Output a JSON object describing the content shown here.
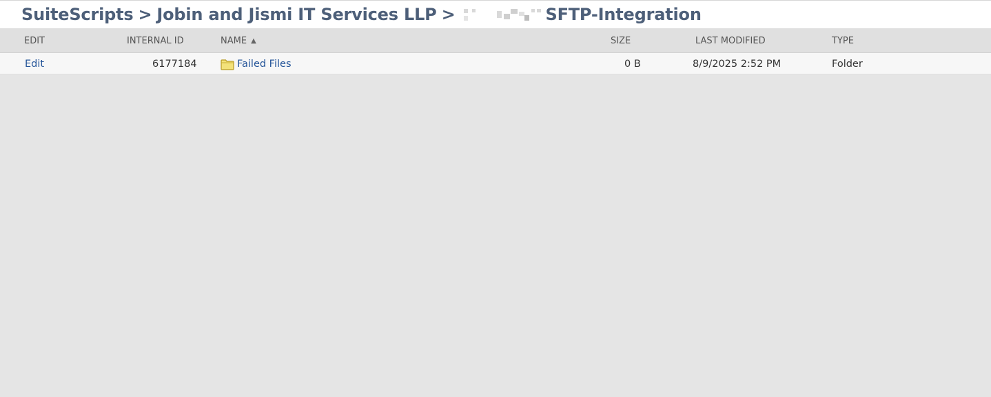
{
  "breadcrumb": {
    "root": "SuiteScripts",
    "separator": ">",
    "company": "Jobin and Jismi IT Services LLP",
    "current": "SFTP-Integration"
  },
  "table": {
    "headers": {
      "edit": "EDIT",
      "internal_id": "INTERNAL ID",
      "name": "NAME",
      "size": "SIZE",
      "last_modified": "LAST MODIFIED",
      "type": "TYPE"
    },
    "sort_indicator": "▲",
    "rows": [
      {
        "edit": "Edit",
        "internal_id": "6177184",
        "name": "Failed Files",
        "size": "0 B",
        "last_modified": "8/9/2025 2:52 PM",
        "type": "Folder",
        "icon": "folder-icon"
      }
    ]
  },
  "colors": {
    "title": "#4d5f79",
    "link": "#255599",
    "folder": "#e6cf5a"
  }
}
